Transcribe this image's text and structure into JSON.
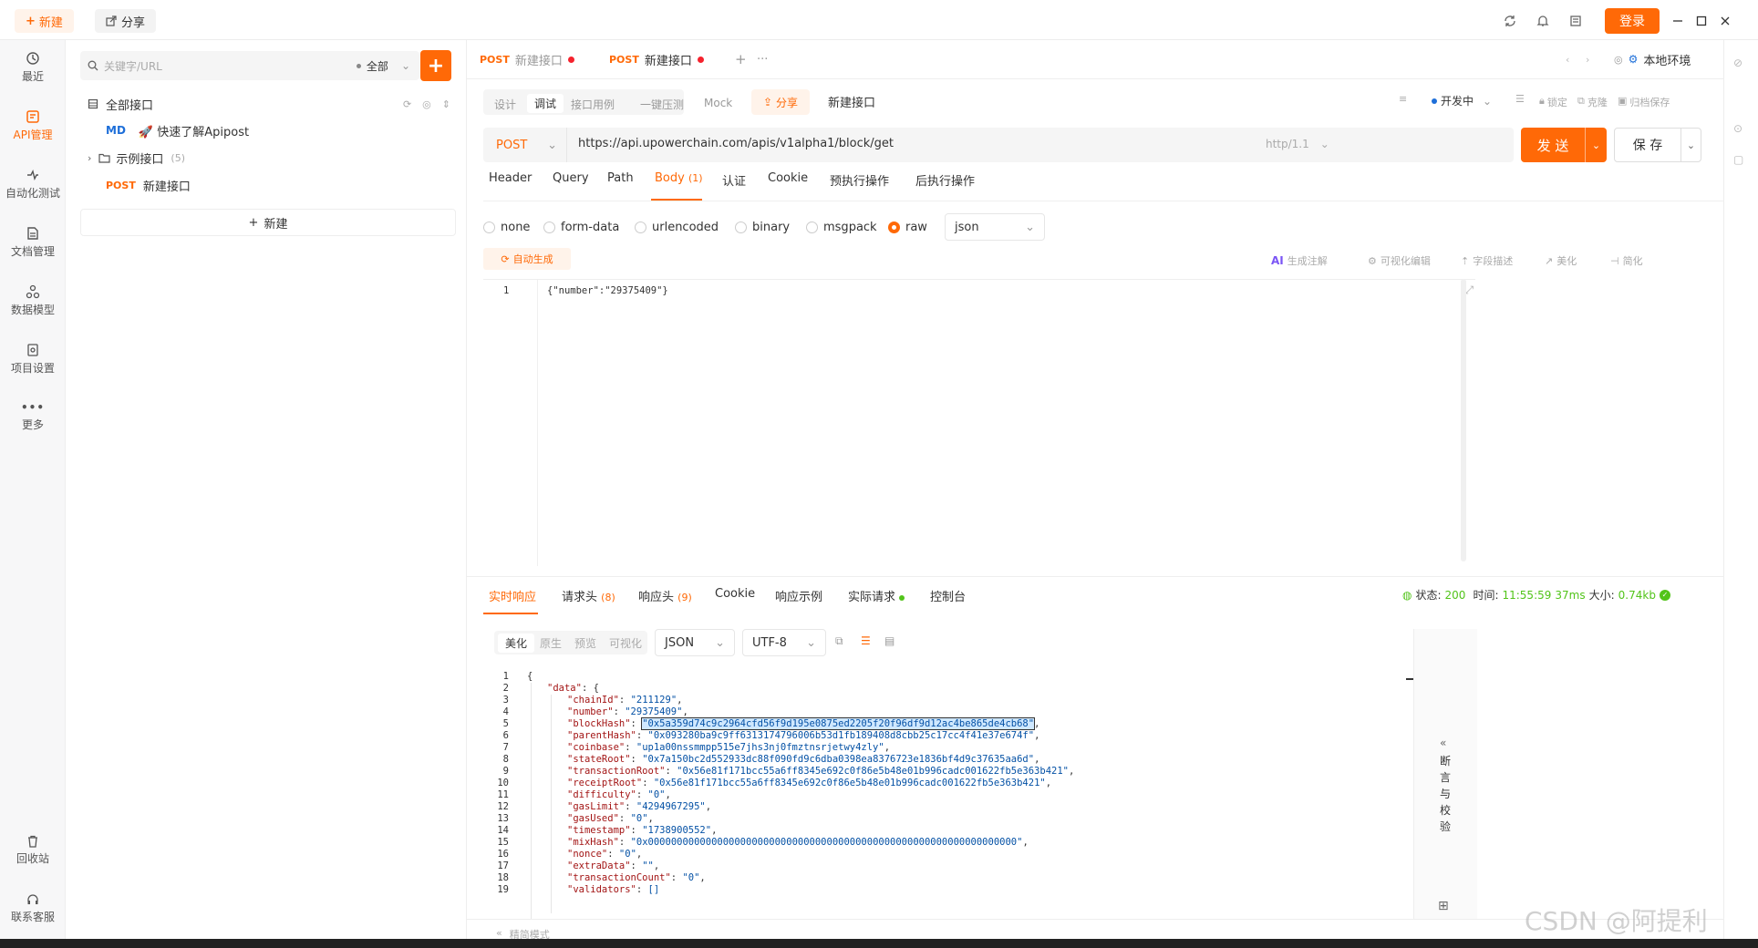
{
  "topbar": {
    "new_label": "新建",
    "share_label": "分享",
    "login_label": "登录"
  },
  "nav": [
    {
      "label": "最近",
      "icon": "history-icon"
    },
    {
      "label": "API管理",
      "icon": "api-icon",
      "active": true
    },
    {
      "label": "自动化测试",
      "icon": "automation-icon"
    },
    {
      "label": "文档管理",
      "icon": "document-icon"
    },
    {
      "label": "数据模型",
      "icon": "data-model-icon"
    },
    {
      "label": "项目设置",
      "icon": "settings-icon"
    },
    {
      "label": "更多",
      "icon": "more-icon"
    }
  ],
  "nav_bottom": [
    {
      "label": "回收站",
      "icon": "trash-icon"
    },
    {
      "label": "联系客服",
      "icon": "headset-icon"
    }
  ],
  "tree": {
    "search_placeholder": "关键字/URL",
    "filter_label": "全部",
    "all_label": "全部接口",
    "items": [
      {
        "tag": "MD",
        "label": "🚀 快速了解Apipost"
      },
      {
        "label": "示例接口",
        "count": "(5)"
      },
      {
        "tag": "POST",
        "label": "新建接口"
      }
    ],
    "add_label": "新建"
  },
  "tabs": [
    {
      "method": "POST",
      "label": "新建接口"
    },
    {
      "method": "POST",
      "label": "新建接口",
      "active": true
    }
  ],
  "env_label": "本地环境",
  "subtabs": [
    "设计",
    "调试",
    "接口用例",
    "一键压测",
    "Mock"
  ],
  "share_label": "分享",
  "api_name": "新建接口",
  "status_controls": {
    "dev": "开发中",
    "lock": "锁定",
    "clone": "克隆",
    "save_archive": "归档保存"
  },
  "request": {
    "method": "POST",
    "url": "https://api.upowerchain.com/apis/v1alpha1/block/get",
    "protocol": "http/1.1",
    "send_label": "发 送",
    "save_label": "保 存"
  },
  "req_tabs": [
    "Header",
    "Query",
    "Path",
    "Body",
    "认证",
    "Cookie",
    "预执行操作",
    "后执行操作"
  ],
  "body_count": "(1)",
  "body_types": [
    "none",
    "form-data",
    "urlencoded",
    "binary",
    "msgpack",
    "raw"
  ],
  "body_format": "json",
  "auto_gen_label": "自动生成",
  "editor_tools": [
    "生成注解",
    "可视化编辑",
    "字段描述",
    "美化",
    "简化"
  ],
  "ai_label": "AI",
  "body_content": "{\"number\":\"29375409\"}",
  "resp_tabs": [
    {
      "label": "实时响应"
    },
    {
      "label": "请求头",
      "count": "(8)"
    },
    {
      "label": "响应头",
      "count": "(9)"
    },
    {
      "label": "Cookie"
    },
    {
      "label": "响应示例"
    },
    {
      "label": "实际请求"
    },
    {
      "label": "控制台"
    }
  ],
  "resp_status": {
    "status_label": "状态:",
    "status": "200",
    "time_label": "时间:",
    "time": "11:55:59",
    "duration": "37ms",
    "size_label": "大小:",
    "size": "0.74kb"
  },
  "view_modes": [
    "美化",
    "原生",
    "预览",
    "可视化"
  ],
  "resp_format": "JSON",
  "resp_encoding": "UTF-8",
  "assert_label": "断言与校验",
  "simple_mode": "精简模式",
  "watermark": "CSDN @阿提利",
  "colors": {
    "accent": "#ff6907",
    "success": "#52c41a",
    "highlight": "#cfe8ff"
  },
  "response_lines": [
    {
      "n": "1",
      "indent": 0,
      "text": "{"
    },
    {
      "n": "2",
      "indent": 1,
      "key": "\"data\"",
      "text": ": {"
    },
    {
      "n": "3",
      "indent": 2,
      "key": "\"chainId\"",
      "val": "\"211129\"",
      "tail": ","
    },
    {
      "n": "4",
      "indent": 2,
      "key": "\"number\"",
      "val": "\"29375409\"",
      "tail": ","
    },
    {
      "n": "5",
      "indent": 2,
      "key": "\"blockHash\"",
      "val": "\"0x5a359d74c9c2964cfd56f9d195e0875ed2205f20f96df9d12ac4be865de4cb68\"",
      "tail": ",",
      "highlight": true
    },
    {
      "n": "6",
      "indent": 2,
      "key": "\"parentHash\"",
      "val": "\"0x093280ba9c9ff6313174796006b53d1fb189408d8cbb25c17cc4f41e37e674f\"",
      "tail": ","
    },
    {
      "n": "7",
      "indent": 2,
      "key": "\"coinbase\"",
      "val": "\"up1a00nssmmpp515e7jhs3nj0fmztnsrjetwy4zly\"",
      "tail": ","
    },
    {
      "n": "8",
      "indent": 2,
      "key": "\"stateRoot\"",
      "val": "\"0x7a150bc2d552933dc88f090fd9c6dba0398ea8376723e1836bf4d9c37635aa6d\"",
      "tail": ","
    },
    {
      "n": "9",
      "indent": 2,
      "key": "\"transactionRoot\"",
      "val": "\"0x56e81f171bcc55a6ff8345e692c0f86e5b48e01b996cadc001622fb5e363b421\"",
      "tail": ","
    },
    {
      "n": "10",
      "indent": 2,
      "key": "\"receiptRoot\"",
      "val": "\"0x56e81f171bcc55a6ff8345e692c0f86e5b48e01b996cadc001622fb5e363b421\"",
      "tail": ","
    },
    {
      "n": "11",
      "indent": 2,
      "key": "\"difficulty\"",
      "val": "\"0\"",
      "tail": ","
    },
    {
      "n": "12",
      "indent": 2,
      "key": "\"gasLimit\"",
      "val": "\"4294967295\"",
      "tail": ","
    },
    {
      "n": "13",
      "indent": 2,
      "key": "\"gasUsed\"",
      "val": "\"0\"",
      "tail": ","
    },
    {
      "n": "14",
      "indent": 2,
      "key": "\"timestamp\"",
      "val": "\"1738900552\"",
      "tail": ","
    },
    {
      "n": "15",
      "indent": 2,
      "key": "\"mixHash\"",
      "val": "\"0x0000000000000000000000000000000000000000000000000000000000000000\"",
      "tail": ","
    },
    {
      "n": "16",
      "indent": 2,
      "key": "\"nonce\"",
      "val": "\"0\"",
      "tail": ","
    },
    {
      "n": "17",
      "indent": 2,
      "key": "\"extraData\"",
      "val": "\"\"",
      "tail": ","
    },
    {
      "n": "18",
      "indent": 2,
      "key": "\"transactionCount\"",
      "val": "\"0\"",
      "tail": ","
    },
    {
      "n": "19",
      "indent": 2,
      "key": "\"validators\"",
      "val": "[]",
      "tail": ""
    }
  ]
}
